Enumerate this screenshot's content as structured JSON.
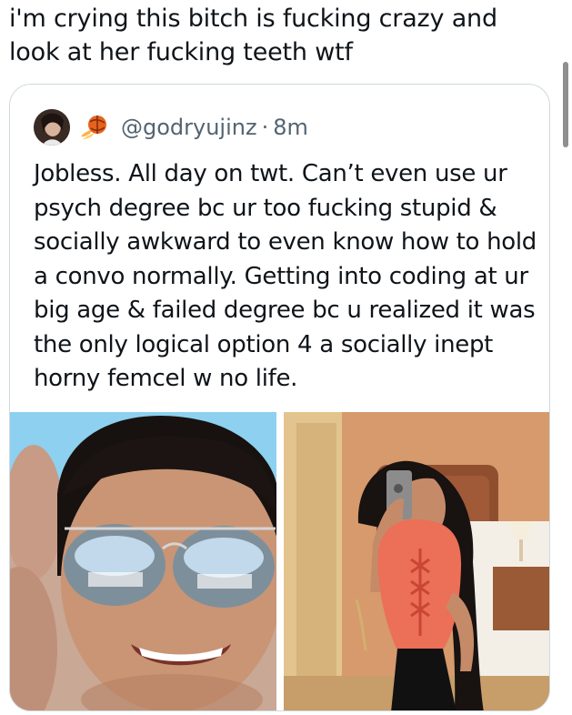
{
  "post": {
    "text": "i'm crying this bitch is fucking crazy and look at her fucking teeth wtf"
  },
  "quoted_post": {
    "avatar_icon": "avatar",
    "badge_icon": "flaming-ball-icon",
    "handle": "@godryujinz",
    "separator": "·",
    "time": "8m",
    "text": "Jobless. All day on twt. Can’t even use ur psych degree bc ur too fucking stupid & socially awkward to even know how to hold a convo normally. Getting into coding at ur big age & failed degree bc u realized it was the only logical option 4 a socially inept horny femcel w no life."
  },
  "colors": {
    "text": "#0f1419",
    "secondary_text": "#536471",
    "border": "#cfd9de"
  }
}
